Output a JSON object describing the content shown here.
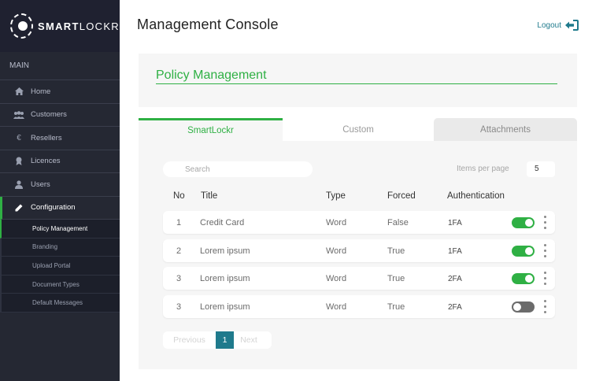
{
  "brand": {
    "bold": "SMART",
    "light": "LOCKR"
  },
  "sidebar": {
    "section": "MAIN",
    "items": [
      {
        "label": "Home",
        "icon": "home-icon"
      },
      {
        "label": "Customers",
        "icon": "users-group-icon"
      },
      {
        "label": "Resellers",
        "icon": "euro-icon"
      },
      {
        "label": "Licences",
        "icon": "badge-icon"
      },
      {
        "label": "Users",
        "icon": "user-icon"
      },
      {
        "label": "Configuration",
        "icon": "pencil-icon"
      }
    ],
    "subitems": [
      {
        "label": "Policy Management"
      },
      {
        "label": "Branding"
      },
      {
        "label": "Upload Portal"
      },
      {
        "label": "Document Types"
      },
      {
        "label": "Default Messages"
      }
    ]
  },
  "header": {
    "title": "Management Console",
    "logout": "Logout"
  },
  "policy": {
    "title": "Policy Management"
  },
  "tabs": [
    {
      "label": "SmartLockr"
    },
    {
      "label": "Custom"
    },
    {
      "label": "Attachments"
    }
  ],
  "search": {
    "placeholder": "Search"
  },
  "items_per_page": {
    "label": "Items per page",
    "value": "5"
  },
  "table": {
    "headers": {
      "no": "No",
      "title": "Title",
      "type": "Type",
      "forced": "Forced",
      "auth": "Authentication"
    },
    "rows": [
      {
        "no": "1",
        "title": "Credit Card",
        "type": "Word",
        "forced": "False",
        "auth": "1FA",
        "enabled": true
      },
      {
        "no": "2",
        "title": "Lorem ipsum",
        "type": "Word",
        "forced": "True",
        "auth": "1FA",
        "enabled": true
      },
      {
        "no": "3",
        "title": "Lorem ipsum",
        "type": "Word",
        "forced": "True",
        "auth": "2FA",
        "enabled": true
      },
      {
        "no": "3",
        "title": "Lorem ipsum",
        "type": "Word",
        "forced": "True",
        "auth": "2FA",
        "enabled": false
      }
    ]
  },
  "pagination": {
    "previous": "Previous",
    "current": "1",
    "next": "Next"
  },
  "colors": {
    "accent": "#2fb044",
    "teal": "#1f7a8c",
    "sidebar": "#252833"
  }
}
